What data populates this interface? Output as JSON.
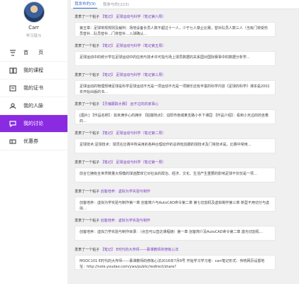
{
  "profile": {
    "name": "Carr",
    "subtitle": "学习就斗"
  },
  "nav": [
    {
      "label": "首　　页",
      "icon": "home-icon"
    },
    {
      "label": "我的课程",
      "icon": "book-icon"
    },
    {
      "label": "我的证书",
      "icon": "certificate-icon"
    },
    {
      "label": "我的人脉",
      "icon": "people-icon"
    },
    {
      "label": "我的讨论",
      "icon": "chat-icon",
      "active": true
    },
    {
      "label": "优惠券",
      "icon": "coupon-icon"
    }
  ],
  "tabs": {
    "mine": "我发布的(9)",
    "replies": "我参与的(223)"
  },
  "accent": "#8a2be2",
  "posts": [
    {
      "prefix": "发表了一个帖子",
      "tag": "【笔记】 足球运动与科学（笔记第六周）",
      "excerpt": "第五章：足球常规规则及裁判：场地设备长员人数不超过十一人，少于七人禁止比赛，替补队员人数三人（当有门将受伤员替补…队员替补…门将替补…入球确认…"
    },
    {
      "prefix": "发表了一个帖子",
      "tag": "【笔记】 足球运动与科学（笔记第五周）",
      "excerpt": "足球运动中的统计学在足球运动中的应用与技术许可指与场上球员数据的关系国对国际赛事中的数据分析学…"
    },
    {
      "prefix": "发表了一个帖子",
      "tag": "【笔记】 足球运动与科学（笔记第三周）",
      "excerpt": "足球运动的物理规律足球是科学足球运动不光是一项运动不光是一项娱乐还有丰富的科学内容《足球的科学》课本是2002年开始出版的书…"
    },
    {
      "prefix": "发表了一个帖子",
      "tag": "【灵魂跟踪大赛】 远不过的的家事心",
      "excerpt": "[图片] 【作品名称】：如未满手心的拥手 【拍摄地点】：泊阳市南城某支路小手下课园 【作品介绍】：看到小天边的的坐着的…"
    },
    {
      "prefix": "发表了一个帖子",
      "tag": "【笔记】 足球运动与科学（笔记第二周）",
      "excerpt": "足球技术:足球技术：球员在比赛中所采用的各种合理动作的总称包括脚的球技术及门将技术是，比赛中常用…"
    },
    {
      "prefix": "发表了一个帖子",
      "tag": "【笔记】 足球运动与科学（笔记第一周）",
      "excerpt": "前言它拥有全世界数量大规模的球迷群体它对社会的政治、经济、文化、生活产生重要的影响足球不仅仅是一项…"
    },
    {
      "prefix": "发表了一个帖子",
      "tag": "创客培养：虚拟为学实验与制作",
      "excerpt": "创客培养：虚拟为学实验与制作第一章 创客简介与AutoCAD命令第二章 第七切割机及虚拟制作第三章 新型不用切分与虚拟…"
    },
    {
      "prefix": "发表了一个帖子",
      "tag": "创客培养：虚拟为学实验与制作",
      "excerpt": "创客培养：虚拟力学实验与制作目录：（点击可以直达课程链）第一章 创客简介及AutoCAD命令第二章 激光切割机…"
    },
    {
      "prefix": "发表了一个帖子",
      "tag": "【笔记】 E时代的大传师——慕课教师的修炼心法",
      "excerpt": "MOOC101 E时代的大传师——慕课教师的修炼心法2016年7月8号 开始学习学习者：carr笔记形式：传统网页设置地址：http://note.youdao.com/yws/public/redirect/share?"
    }
  ]
}
